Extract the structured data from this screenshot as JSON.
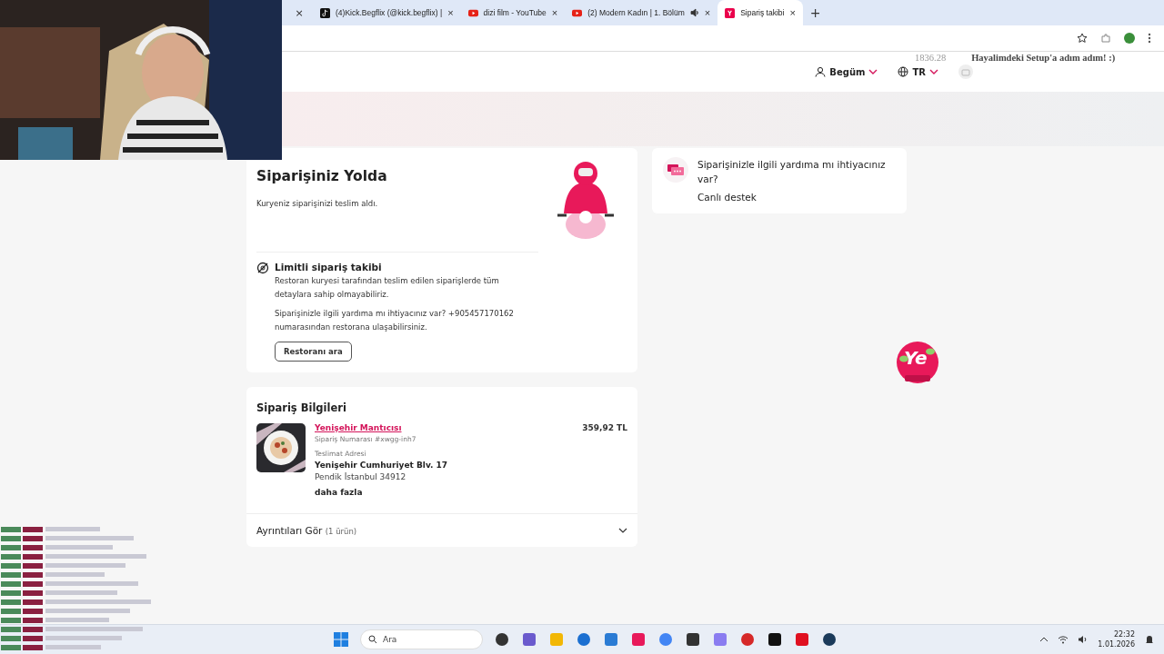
{
  "browser": {
    "hidden_tab_close": "×",
    "tabs": [
      {
        "title": "(4)Kick.Begflix (@kick.begflix) |",
        "kind": "tiktok",
        "audio": false,
        "selected": false,
        "close": "×"
      },
      {
        "title": "dizi film - YouTube",
        "kind": "youtube",
        "audio": false,
        "selected": false,
        "close": "×"
      },
      {
        "title": "(2) Modern Kadın | 1. Bölüm",
        "kind": "youtube",
        "audio": true,
        "selected": false,
        "close": "×"
      },
      {
        "title": "Sipariş takibi",
        "kind": "yemek",
        "audio": false,
        "selected": true,
        "close": "×"
      }
    ],
    "new_tab": "+"
  },
  "stream_overlay": {
    "counter": "1836.28",
    "goal": "Hayalimdeki Setup'a adım adım! :)"
  },
  "header": {
    "user": "Begüm",
    "language": "TR"
  },
  "status_card": {
    "title": "Siparişiniz Yolda",
    "subtitle": "Kuryeniz siparişinizi teslim aldı.",
    "notice_title": "Limitli sipariş takibi",
    "notice_text": "Restoran kuryesi tarafından teslim edilen siparişlerde tüm detaylara sahip olmayabiliriz.",
    "help_text": "Siparişinizle ilgili yardıma mı ihtiyacınız var? +905457170162 numarasından restorana ulaşabilirsiniz.",
    "button": "Restoranı ara"
  },
  "order_card": {
    "title": "Sipariş Bilgileri",
    "restaurant": "Yenişehir Mantıcısı",
    "price": "359,92 TL",
    "order_number": "Sipariş Numarası #xwgg-inh7",
    "address_label": "Teslimat Adresi",
    "address_line1": "Yenişehir Cumhuriyet Blv. 17",
    "address_line2": "Pendik İstanbul 34912",
    "more": "daha fazla",
    "details": "Ayrıntıları Gör",
    "details_count": "(1 ürün)",
    "expanded": false
  },
  "support_card": {
    "question": "Siparişinizle ilgili yardıma mı ihtiyacınız var?",
    "link": "Canlı destek"
  },
  "promo_badge": {
    "text": "Ye"
  },
  "taskbar": {
    "search_placeholder": "Ara",
    "time": "22:32",
    "date": "1.01.2026"
  }
}
